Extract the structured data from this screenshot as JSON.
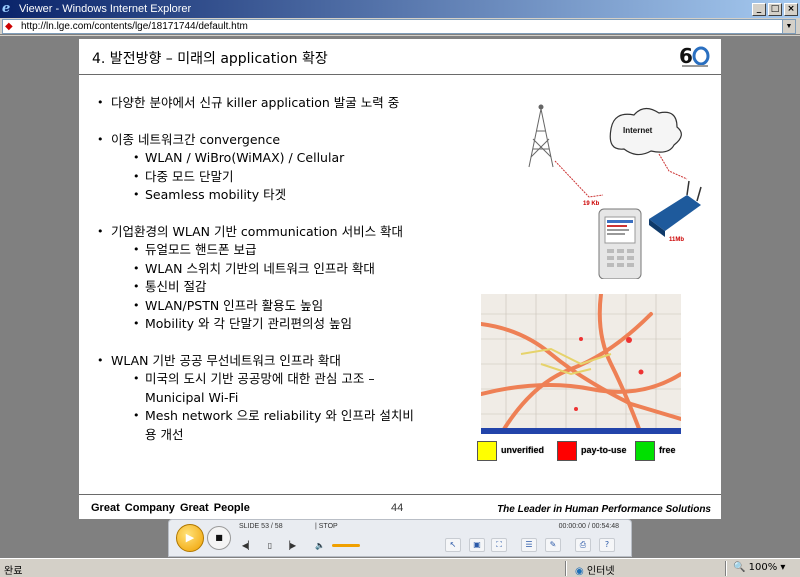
{
  "window": {
    "title": "Viewer - Windows Internet Explorer",
    "controls": {
      "minimize": "_",
      "maximize": "□",
      "close": "×"
    }
  },
  "address": {
    "url": "http://ln.lge.com/contents/lge/18171744/default.htm"
  },
  "slide": {
    "title": "4. 발전방향 – 미래의 application 확장",
    "bullets": [
      {
        "text": "다양한 분야에서 신규 killer application 발굴 노력 중",
        "subs": []
      },
      {
        "text": "이종 네트워크간 convergence",
        "subs": [
          "WLAN / WiBro(WiMAX) / Cellular",
          "다중 모드 단말기",
          "Seamless mobility 타겟"
        ]
      },
      {
        "text": "기업환경의 WLAN 기반 communication 서비스 확대",
        "subs": [
          "듀얼모드 핸드폰 보급",
          "WLAN 스위치 기반의 네트워크 인프라 확대",
          "통신비 절감",
          "WLAN/PSTN 인프라 활용도 높임",
          "Mobility 와 각 단말기 관리편의성 높임"
        ]
      },
      {
        "text": "WLAN 기반 공공 무선네트워크 인프라 확대",
        "subs": [
          "미국의 도시 기반 공공망에 대한 관심 고조 –",
          "Municipal Wi-Fi",
          "Mesh network 으로 reliability 와 인프라 설치비",
          "용 개선"
        ]
      }
    ],
    "figure_labels": {
      "internet": "Internet",
      "speed1": "19 Kb",
      "speed2": "11Mb"
    },
    "legend": [
      {
        "label": "unverified",
        "color": "#ffff00"
      },
      {
        "label": "pay-to-use",
        "color": "#ff0000"
      },
      {
        "label": "free",
        "color": "#00e000"
      }
    ],
    "footer": {
      "left": "Great Company   Great People",
      "page": "44",
      "right": "The Leader in Human Performance Solutions"
    }
  },
  "player": {
    "slide_counter": "SLIDE 53 / 58",
    "state": "| STOP",
    "time": "00:00:00 / 00:54:48"
  },
  "status": {
    "done": "완료",
    "zone": "인터넷",
    "zoom": "100%"
  },
  "colors": {
    "titlebar": "#0a246a",
    "accent": "#f0a000",
    "road": "#f08050"
  }
}
